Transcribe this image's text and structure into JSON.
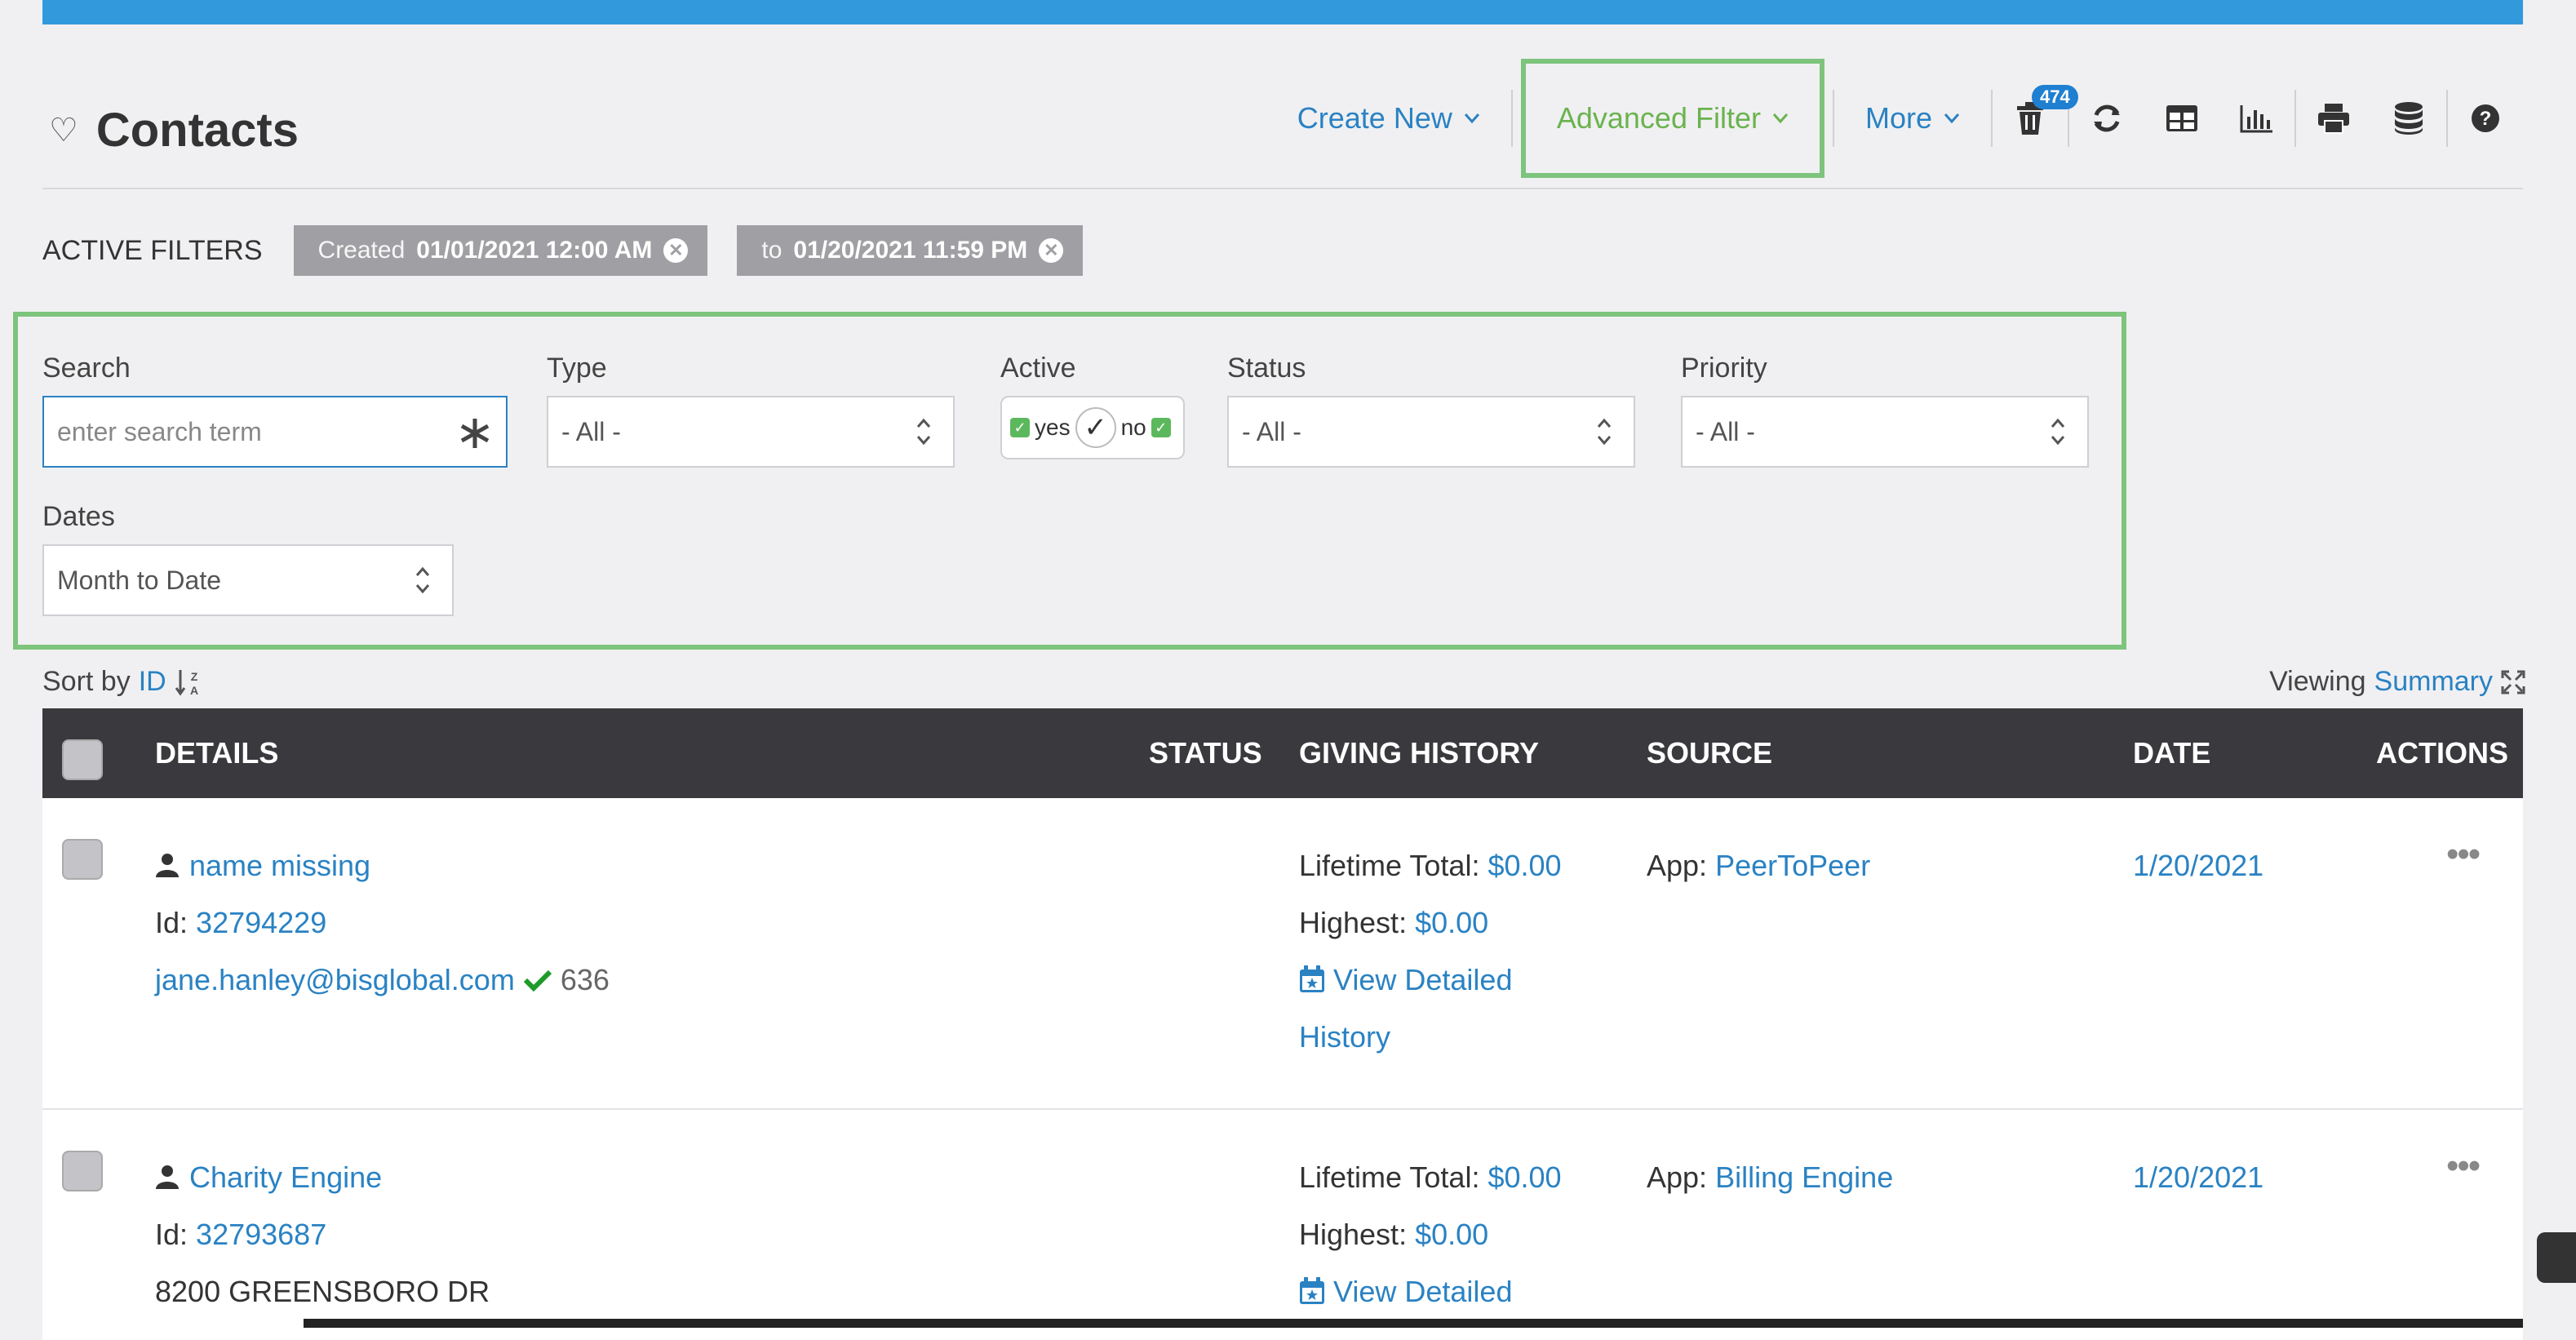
{
  "header": {
    "title": "Contacts",
    "create_new": "Create New",
    "advanced_filter": "Advanced Filter",
    "more": "More",
    "trash_count": "474"
  },
  "active_filters": {
    "label": "ACTIVE FILTERS",
    "chips": [
      {
        "key": "Created",
        "value": "01/01/2021 12:00 AM"
      },
      {
        "key": "to",
        "value": "01/20/2021 11:59 PM"
      }
    ]
  },
  "filters": {
    "search": {
      "label": "Search",
      "placeholder": "enter search term"
    },
    "type": {
      "label": "Type",
      "value": "- All -"
    },
    "active": {
      "label": "Active",
      "yes": "yes",
      "no": "no"
    },
    "status": {
      "label": "Status",
      "value": "- All -"
    },
    "priority": {
      "label": "Priority",
      "value": "- All -"
    },
    "dates": {
      "label": "Dates",
      "value": "Month to Date"
    }
  },
  "sort": {
    "label": "Sort by",
    "field": "ID"
  },
  "viewing": {
    "label": "Viewing",
    "mode": "Summary"
  },
  "table": {
    "columns": [
      "DETAILS",
      "STATUS",
      "GIVING HISTORY",
      "SOURCE",
      "DATE",
      "ACTIONS"
    ],
    "rows": [
      {
        "name": "name missing",
        "id_label": "Id:",
        "id": "32794229",
        "email": "jane.hanley@bisglobal.com",
        "extra": "636",
        "lifetime_label": "Lifetime Total:",
        "lifetime": "$0.00",
        "highest_label": "Highest:",
        "highest": "$0.00",
        "history_1": "View Detailed",
        "history_2": "History",
        "source_label": "App:",
        "source": "PeerToPeer",
        "date": "1/20/2021"
      },
      {
        "name": "Charity Engine",
        "id_label": "Id:",
        "id": "32793687",
        "address": "8200 GREENSBORO DR",
        "lifetime_label": "Lifetime Total:",
        "lifetime": "$0.00",
        "highest_label": "Highest:",
        "highest": "$0.00",
        "history_1": "View Detailed",
        "source_label": "App:",
        "source": "Billing Engine",
        "date": "1/20/2021"
      }
    ]
  },
  "colors": {
    "accent": "#2a82c3",
    "highlight": "#7dc47d",
    "header_bg": "#3a3a3e",
    "topbar": "#3399dd"
  }
}
